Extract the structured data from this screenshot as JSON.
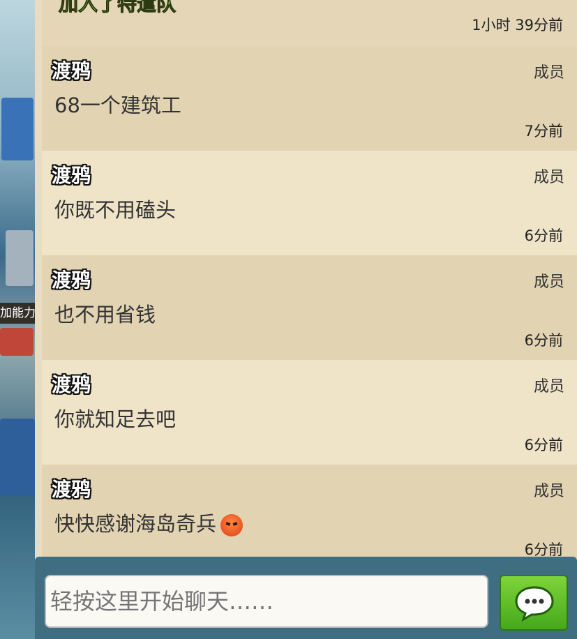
{
  "top_message": {
    "title": "加入了特遣队",
    "time": "1小时 39分前"
  },
  "messages": [
    {
      "sender": "渡鸦",
      "role": "成员",
      "text": "68一个建筑工",
      "time": "7分前",
      "emoji": ""
    },
    {
      "sender": "渡鸦",
      "role": "成员",
      "text": "你既不用磕头",
      "time": "6分前",
      "emoji": ""
    },
    {
      "sender": "渡鸦",
      "role": "成员",
      "text": "也不用省钱",
      "time": "6分前",
      "emoji": ""
    },
    {
      "sender": "渡鸦",
      "role": "成员",
      "text": "你就知足去吧",
      "time": "6分前",
      "emoji": ""
    },
    {
      "sender": "渡鸦",
      "role": "成员",
      "text": "快快感谢海岛奇兵",
      "time": "6分前",
      "emoji": "angry-face"
    }
  ],
  "game_strip": {
    "label": "加能力"
  },
  "input": {
    "placeholder": "轻按这里开始聊天……"
  },
  "colors": {
    "panel": "#e9dcc0",
    "send_button": "#5cbf2a",
    "input_bar": "#3f6e82"
  }
}
